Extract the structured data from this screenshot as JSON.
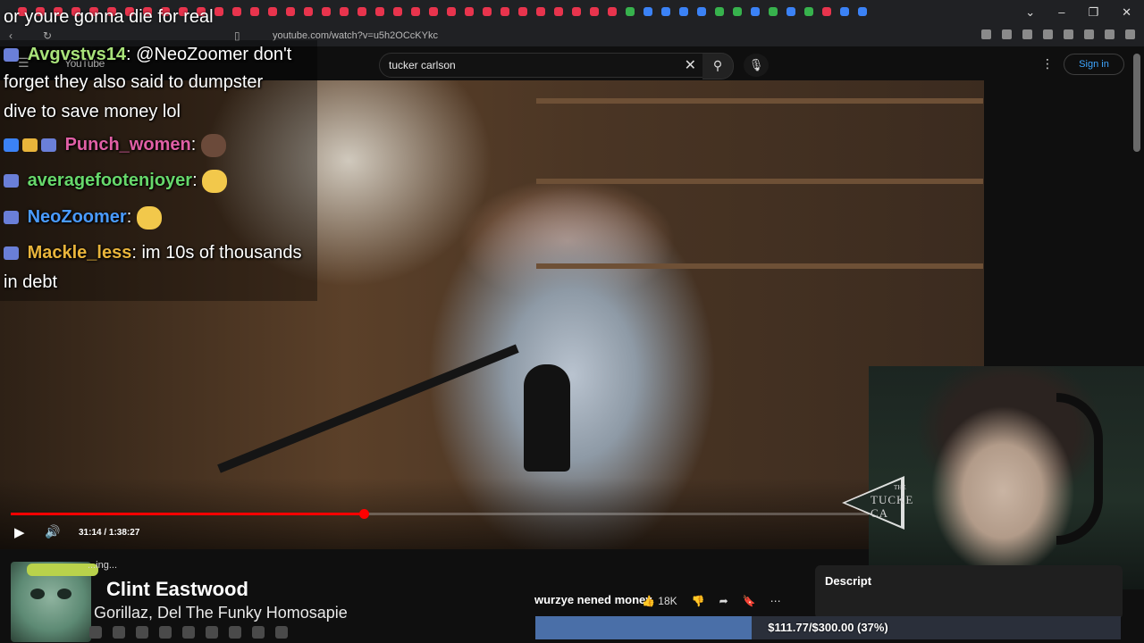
{
  "browser": {
    "url": "youtube.com/watch?v=u5h2OCcKYkc"
  },
  "youtube": {
    "logo": "YouTube",
    "search_value": "tucker carlson",
    "sign_in": "Sign in",
    "video_title": "wurzye nened money",
    "likes": "18K",
    "description_label": "Descript"
  },
  "player": {
    "timecode": "31:14 / 1:38:27",
    "progress": 0.3674
  },
  "chat": {
    "top_line": "or youre gonna die for real",
    "messages": [
      {
        "user": "Avgvstvs14",
        "text": "@NeoZoomer don't",
        "color": "#a9e37a"
      },
      {
        "cont": "forget they also said to dumpster"
      },
      {
        "cont": "dive to save money lol"
      },
      {
        "user": "Punch_women",
        "text": "",
        "color": "#e05fa5"
      },
      {
        "user": "averagefootenjoyer",
        "text": "",
        "color": "#67d86b"
      },
      {
        "user": "NeoZoomer",
        "text": "",
        "color": "#4a9bff"
      },
      {
        "user": "Mackle_less",
        "text": "im 10s of thousands",
        "color": "#e8b43b"
      },
      {
        "cont": "in debt"
      }
    ]
  },
  "now_playing": {
    "status": "...ing...",
    "title": "Clint Eastwood",
    "artist": "Gorillaz, Del The Funky Homosapie"
  },
  "donation_goal": {
    "text": "$111.77/$300.00 (37%)",
    "fraction": 0.37
  },
  "overlay_logo": {
    "the": "THE",
    "line1": "TUCKE",
    "line2": "CA"
  }
}
